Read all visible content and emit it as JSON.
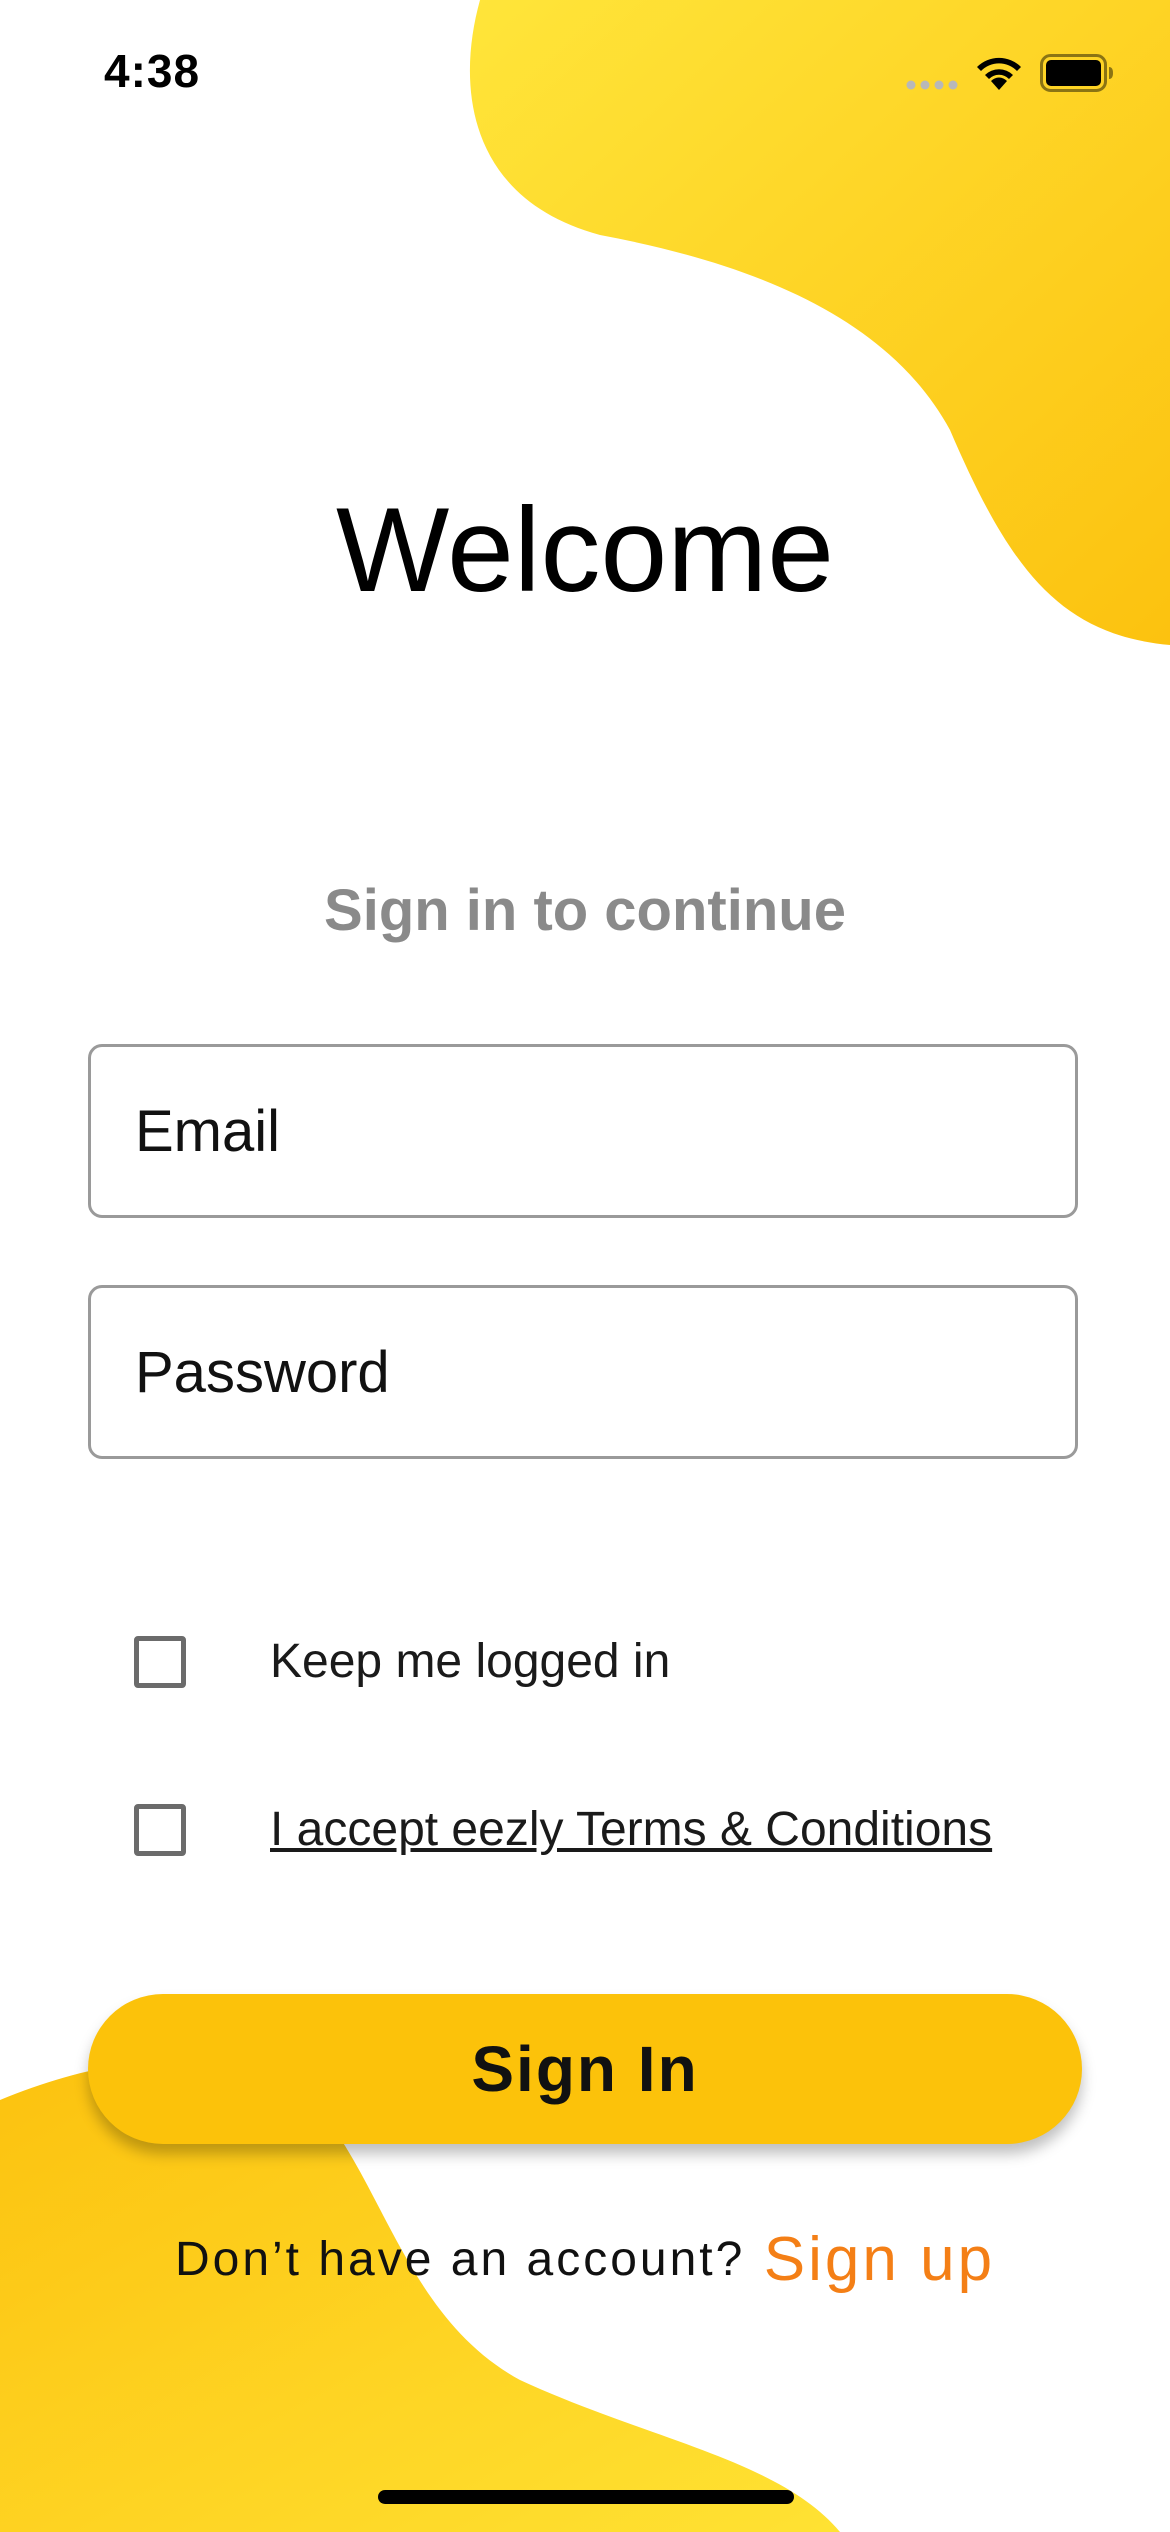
{
  "status_bar": {
    "time": "4:38"
  },
  "screen": {
    "title": "Welcome",
    "subtitle": "Sign in to continue"
  },
  "form": {
    "email_placeholder": "Email",
    "password_placeholder": "Password",
    "keep_logged_in_label": "Keep me logged in",
    "terms_label": "I accept eezly Terms & Conditions",
    "sign_in_label": "Sign In"
  },
  "footer": {
    "prompt": "Don’t have an account?",
    "sign_up_label": "Sign up"
  },
  "colors": {
    "accent_yellow": "#fcc20a",
    "link_orange": "#f47f16",
    "subtitle_gray": "#8a8a8a"
  },
  "icons": [
    "signal-dots-icon",
    "wifi-icon",
    "battery-icon"
  ]
}
